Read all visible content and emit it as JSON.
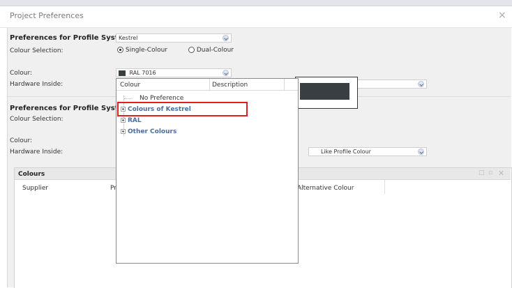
{
  "window": {
    "title": "Project Preferences",
    "close_glyph": "×"
  },
  "section1": {
    "heading": "Preferences for Profile System",
    "profile_value": "Kestrel",
    "colour_selection_label": "Colour Selection:",
    "single_colour_label": "Single-Colour",
    "dual_colour_label": "Dual-Colour",
    "colour_label": "Colour:",
    "colour_value": "RAL 7016",
    "hardware_label": "Hardware Inside:"
  },
  "section2": {
    "heading": "Preferences for Profile System",
    "colour_selection_label": "Colour Selection:",
    "colour_label": "Colour:",
    "hardware_label": "Hardware Inside:",
    "hardware_value": "Like Profile Colour"
  },
  "colours_panel": {
    "title": "Colours",
    "columns": [
      "Supplier",
      "Pr",
      "Alternative Colour"
    ],
    "toolbar_icons": [
      "document-icon",
      "copy-icon",
      "close-icon"
    ]
  },
  "dropdown": {
    "columns": [
      "Colour",
      "Description"
    ],
    "items": [
      {
        "label": "No Preference",
        "expandable": false
      },
      {
        "label": "Colours of Kestrel",
        "expandable": true
      },
      {
        "label": "RAL",
        "expandable": true
      },
      {
        "label": "Other Colours",
        "expandable": true
      }
    ]
  },
  "colors": {
    "swatch": "#383e42",
    "highlight": "#e02020",
    "tree_text": "#4a6d9b"
  }
}
